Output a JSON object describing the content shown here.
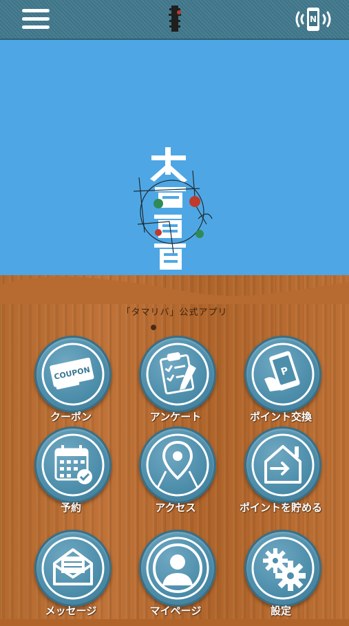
{
  "header": {
    "menu_icon": "hamburger-menu-icon",
    "logo_icon": "taishu-sakaba-logo",
    "nfc_icon": "nfc-phone-icon"
  },
  "hero": {
    "logo": "大衆酒場 logo",
    "background_color": "#4ea7e4"
  },
  "subtitle": "「タマリバ」公式アプリ",
  "menu": [
    {
      "label": "クーポン",
      "icon": "coupon-icon",
      "icon_text": "COUPON"
    },
    {
      "label": "アンケート",
      "icon": "clipboard-survey-icon"
    },
    {
      "label": "ポイント交換",
      "icon": "point-exchange-icon",
      "icon_text": "P"
    },
    {
      "label": "予約",
      "icon": "calendar-reserve-icon"
    },
    {
      "label": "アクセス",
      "icon": "map-pin-icon"
    },
    {
      "label": "ポイントを貯める",
      "icon": "enter-home-icon"
    },
    {
      "label": "メッセージ",
      "icon": "mail-icon"
    },
    {
      "label": "マイページ",
      "icon": "user-profile-icon"
    },
    {
      "label": "設定",
      "icon": "gears-icon"
    }
  ]
}
